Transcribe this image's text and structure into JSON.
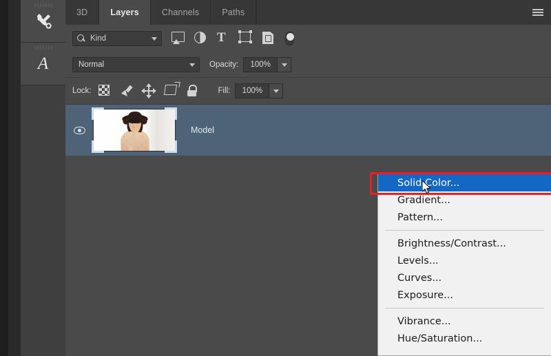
{
  "window": {
    "app": "Adobe Photoshop",
    "panel_menu_icon": "hamburger-icon"
  },
  "icon_dock": {
    "buttons": [
      {
        "name": "tools-panel-icon",
        "glyph": "tools"
      },
      {
        "name": "character-panel-icon",
        "glyph": "A"
      }
    ]
  },
  "tabs": [
    {
      "label": "3D",
      "active": false
    },
    {
      "label": "Layers",
      "active": true
    },
    {
      "label": "Channels",
      "active": false
    },
    {
      "label": "Paths",
      "active": false
    }
  ],
  "filter_row": {
    "kind_label": "Kind",
    "search_icon": "magnifier-icon",
    "dropdown_icon": "chevron-down-icon",
    "filter_icons": [
      "pixel-layer-filter-icon",
      "adjustment-layer-filter-icon",
      "type-layer-filter-icon",
      "shape-layer-filter-icon",
      "smart-object-filter-icon"
    ],
    "toggle_icon": "filter-enable-toggle"
  },
  "blend_row": {
    "blend_mode": "Normal",
    "opacity_label": "Opacity:",
    "opacity_value": "100%"
  },
  "lock_row": {
    "lock_label": "Lock:",
    "lock_icons": [
      "transparency-lock-icon",
      "image-pixels-lock-icon",
      "position-lock-icon",
      "artboard-nesting-lock-icon",
      "lock-all-icon"
    ],
    "fill_label": "Fill:",
    "fill_value": "100%"
  },
  "layers": [
    {
      "name": "Model",
      "visible": true,
      "selected": true,
      "thumbnail": "woman-in-hat-photo"
    }
  ],
  "context_menu": {
    "groups": [
      {
        "items": [
          {
            "label": "Solid Color...",
            "highlighted": true
          },
          {
            "label": "Gradient...",
            "highlighted": false
          },
          {
            "label": "Pattern...",
            "highlighted": false
          }
        ]
      },
      {
        "items": [
          {
            "label": "Brightness/Contrast...",
            "highlighted": false
          },
          {
            "label": "Levels...",
            "highlighted": false
          },
          {
            "label": "Curves...",
            "highlighted": false
          },
          {
            "label": "Exposure...",
            "highlighted": false
          }
        ]
      },
      {
        "items": [
          {
            "label": "Vibrance...",
            "highlighted": false
          },
          {
            "label": "Hue/Saturation...",
            "highlighted": false
          }
        ]
      }
    ]
  },
  "annotation": {
    "type": "red-rectangle-highlight",
    "target": "Solid Color..."
  },
  "colors": {
    "panel_bg": "#4a4a4a",
    "tabbar_bg": "#373737",
    "selected_layer": "#4f6378",
    "menu_bg": "#f1f1f1",
    "menu_highlight": "#1268c3",
    "annotation_red": "#ee1c25"
  }
}
